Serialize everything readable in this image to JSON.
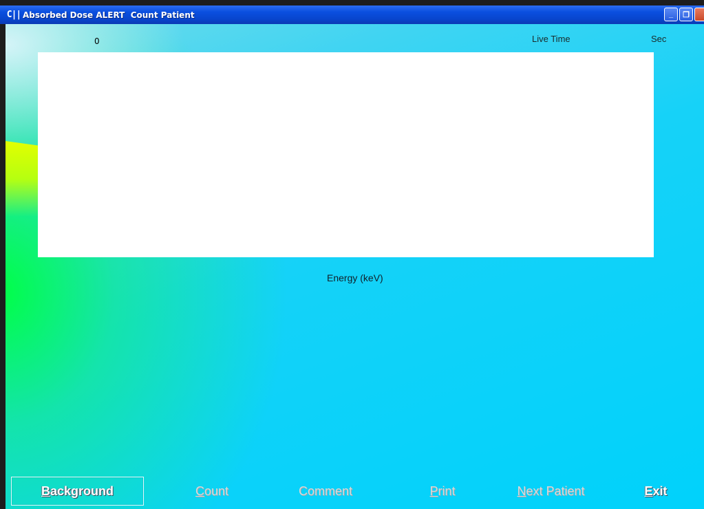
{
  "window": {
    "logo_text": "C||",
    "title": "Absorbed Dose ALERT  Count Patient",
    "controls": [
      "minimize",
      "restore",
      "close"
    ]
  },
  "plot": {
    "y_max_label": "0",
    "live_time_label": "Live Time",
    "sec_label": "Sec",
    "x_axis_label": "Energy (keV)"
  },
  "buttons": [
    {
      "key": "B",
      "rest": "ackground",
      "enabled": true,
      "focused": true
    },
    {
      "key": "C",
      "rest": "ount",
      "enabled": false
    },
    {
      "key": "",
      "rest": "Comment",
      "enabled": false
    },
    {
      "key": "P",
      "rest": "rint",
      "enabled": false
    },
    {
      "key": "N",
      "rest": "ext Patient",
      "enabled": false
    },
    {
      "key": "E",
      "rest": "xit",
      "enabled": true
    }
  ],
  "colors": {
    "titlebar": "#0a4fdf",
    "plot_background": "#ffffff",
    "client_accent": "#00d2fb"
  }
}
